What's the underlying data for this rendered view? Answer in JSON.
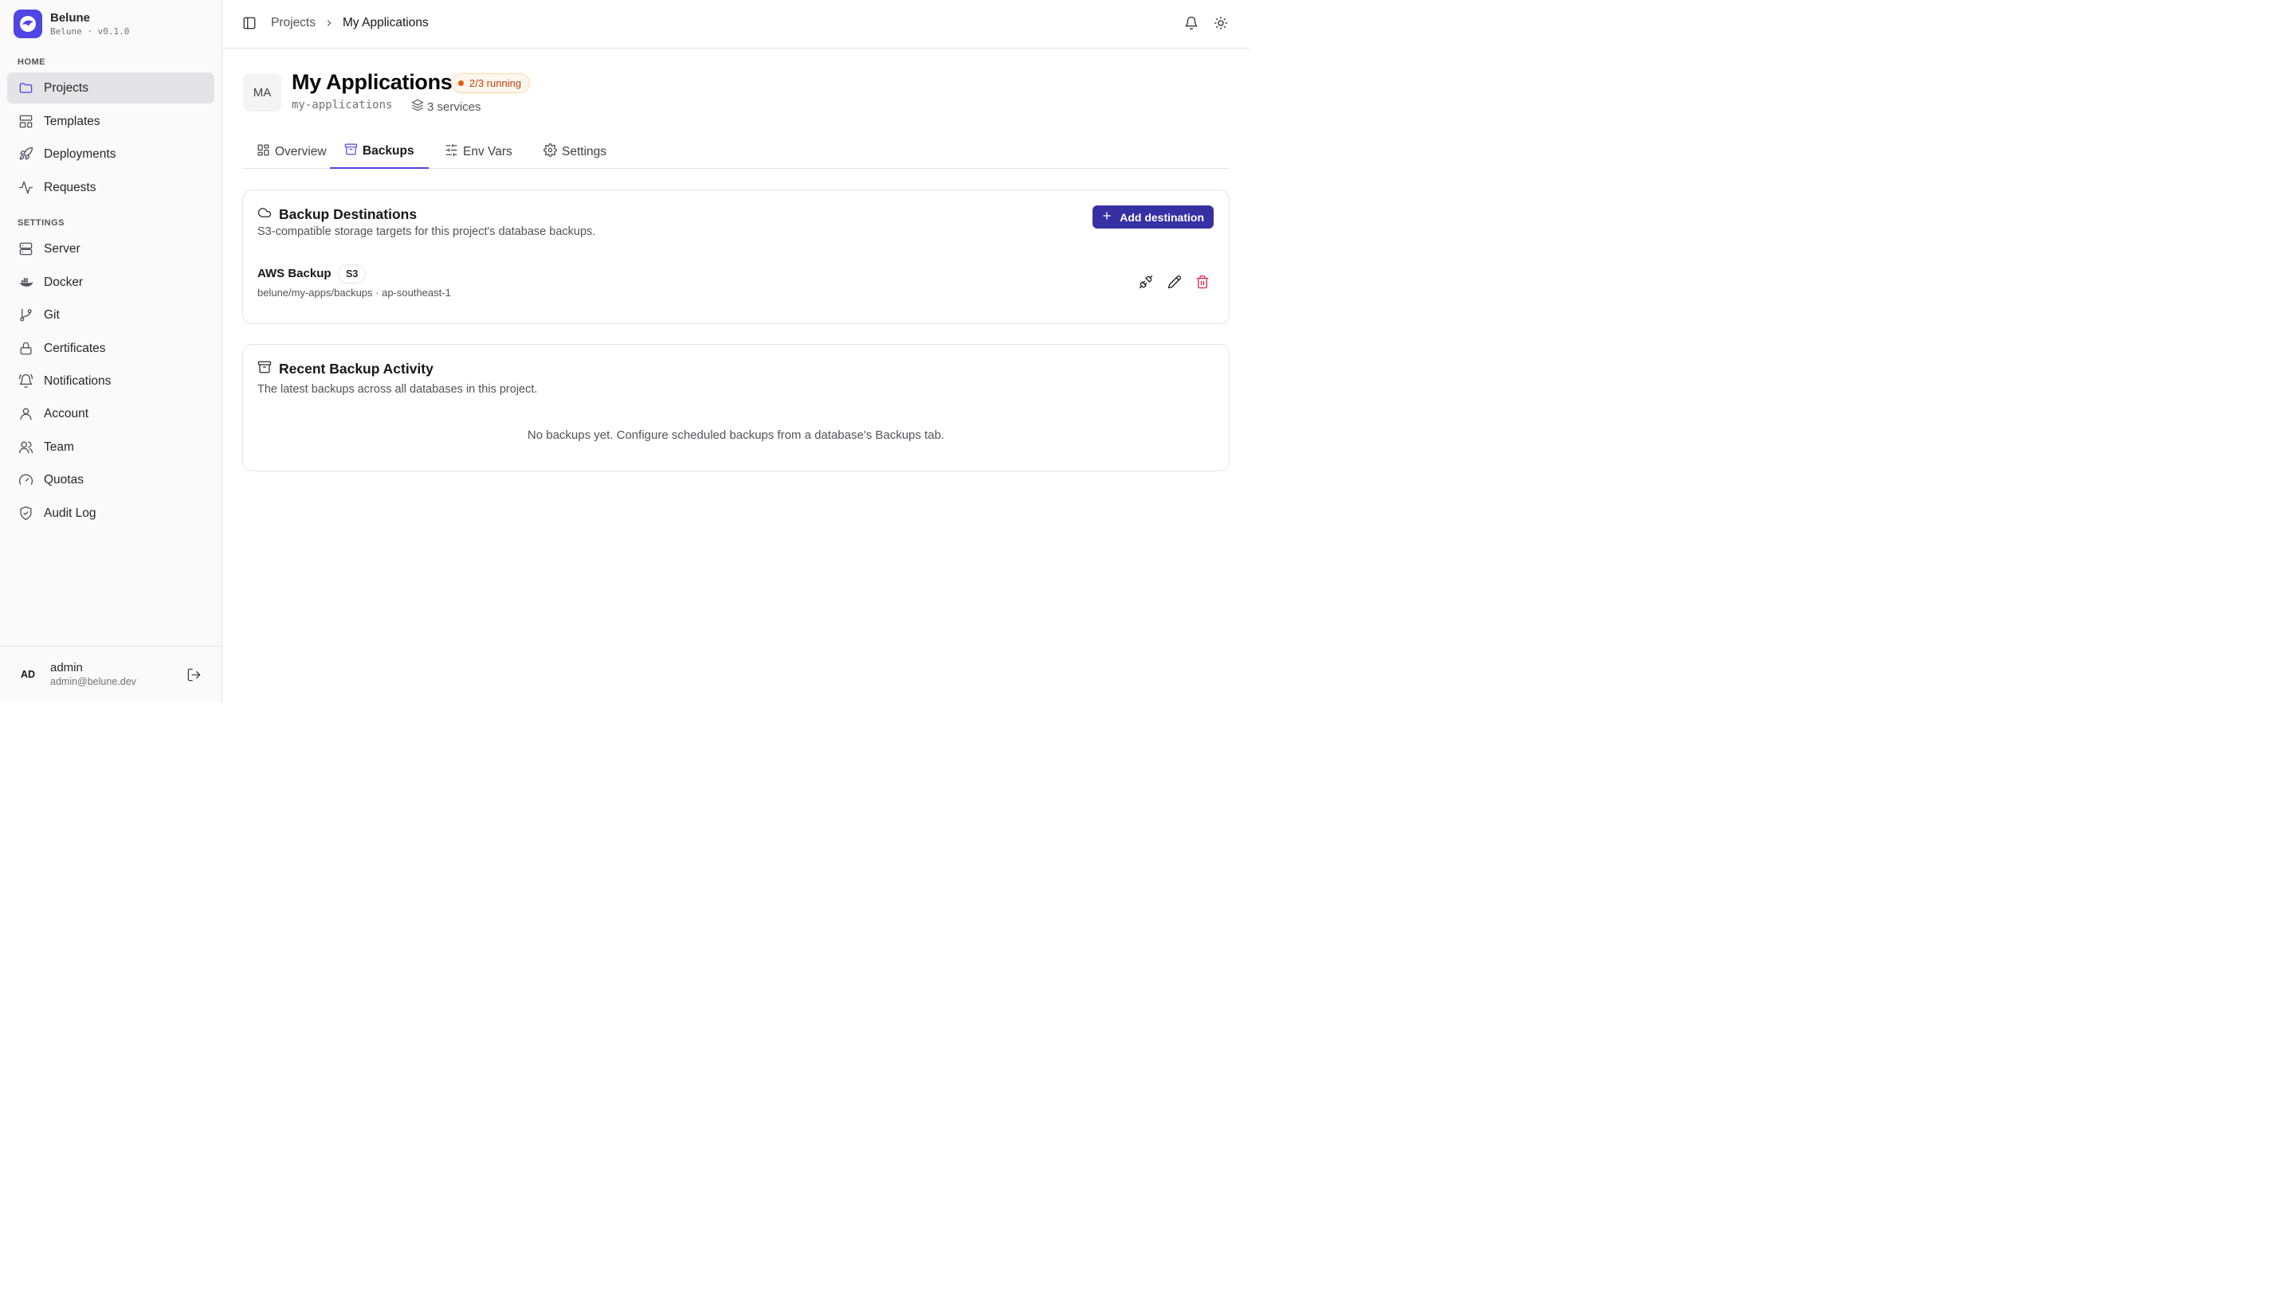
{
  "brand": {
    "name": "Belune",
    "version": "Belune · v0.1.0"
  },
  "sidebar": {
    "home_label": "HOME",
    "settings_label": "SETTINGS",
    "home_items": [
      {
        "label": "Projects",
        "icon": "folder-icon",
        "active": true
      },
      {
        "label": "Templates",
        "icon": "layout-icon"
      },
      {
        "label": "Deployments",
        "icon": "rocket-icon"
      },
      {
        "label": "Requests",
        "icon": "activity-icon"
      }
    ],
    "settings_items": [
      {
        "label": "Server",
        "icon": "server-icon"
      },
      {
        "label": "Docker",
        "icon": "docker-icon"
      },
      {
        "label": "Git",
        "icon": "git-branch-icon"
      },
      {
        "label": "Certificates",
        "icon": "lock-icon"
      },
      {
        "label": "Notifications",
        "icon": "bell-ring-icon"
      },
      {
        "label": "Account",
        "icon": "user-icon"
      },
      {
        "label": "Team",
        "icon": "users-icon"
      },
      {
        "label": "Quotas",
        "icon": "gauge-icon"
      },
      {
        "label": "Audit Log",
        "icon": "shield-check-icon"
      }
    ],
    "user": {
      "initials": "AD",
      "name": "admin",
      "email": "admin@belune.dev"
    }
  },
  "header": {
    "breadcrumb": [
      "Projects",
      "My Applications"
    ]
  },
  "project": {
    "initials": "MA",
    "title": "My Applications",
    "status": "2/3 running",
    "slug": "my-applications",
    "services": "3 services"
  },
  "tabs": [
    {
      "label": "Overview",
      "icon": "grid-icon"
    },
    {
      "label": "Backups",
      "icon": "archive-icon",
      "active": true
    },
    {
      "label": "Env Vars",
      "icon": "sliders-icon"
    },
    {
      "label": "Settings",
      "icon": "gear-icon"
    }
  ],
  "destinations": {
    "title": "Backup Destinations",
    "description": "S3-compatible storage targets for this project's database backups.",
    "add_button": "Add destination",
    "items": [
      {
        "name": "AWS Backup",
        "type": "S3",
        "path": "belune/my-apps/backups · ap-southeast-1"
      }
    ]
  },
  "activity": {
    "title": "Recent Backup Activity",
    "description": "The latest backups across all databases in this project.",
    "empty": "No backups yet. Configure scheduled backups from a database's Backups tab."
  },
  "colors": {
    "accent": "#4f46e5",
    "button": "#3730a3",
    "status": "#c2410c",
    "danger": "#e11d48"
  }
}
